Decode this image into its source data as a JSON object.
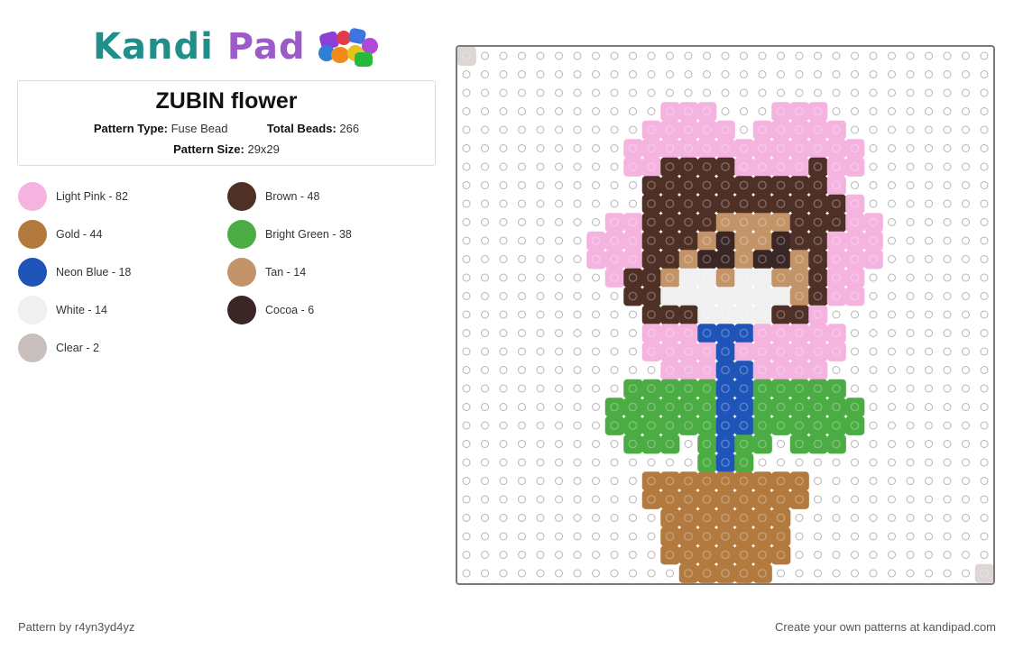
{
  "brand": {
    "logo_part1": "Kandi",
    "logo_part2": "Pad",
    "colors": {
      "kandi": "#1f8f8a",
      "pad": "#9c5bc9"
    }
  },
  "pattern": {
    "title": "ZUBIN flower",
    "type_label": "Pattern Type:",
    "type_value": "Fuse Bead",
    "total_label": "Total Beads:",
    "total_value": "266",
    "size_label": "Pattern Size:",
    "size_value": "29x29"
  },
  "legend": [
    {
      "label": "Light Pink - 82",
      "color": "#f5b3df"
    },
    {
      "label": "Brown - 48",
      "color": "#4f3027"
    },
    {
      "label": "Gold - 44",
      "color": "#b27a3f"
    },
    {
      "label": "Bright Green - 38",
      "color": "#4aac42"
    },
    {
      "label": "Neon Blue - 18",
      "color": "#1f55b8"
    },
    {
      "label": "Tan - 14",
      "color": "#c29468"
    },
    {
      "label": "White - 14",
      "color": "#f0f0f0"
    },
    {
      "label": "Cocoa - 6",
      "color": "#3a2624"
    },
    {
      "label": "Clear - 2",
      "color": "#c8bebb"
    }
  ],
  "grid": {
    "cols": 29,
    "rows": 29,
    "palette": {
      ".": "#ffffff",
      "P": "#f5b3df",
      "B": "#4f3027",
      "G": "#b27a3f",
      "E": "#4aac42",
      "N": "#1f55b8",
      "T": "#c29468",
      "W": "#f0f0f0",
      "C": "#3a2624",
      "X": "#dcd6d4"
    },
    "rows_data": [
      "X............................",
      ".............................",
      ".............................",
      "...........PPP...PPP.........",
      "..........PPPPP.PPPPP........",
      ".........PPPPPPPPPPPPP.......",
      ".........PPBBBBPPPPBPP.......",
      "..........BBBBBBBBBBP........",
      "..........BBBBBBBBBBBP.......",
      "........PPBBBBTTTTBBBPP......",
      ".......PPPBBBTCTTCBBPPP......",
      ".......PPPBBTCCTCCTBPPP......",
      "........PBBTWWTWWTTBPP.......",
      ".........BBWWWWWWWTBPP.......",
      "..........BBBWWWWBBP.........",
      "..........PPPNNNPPPPP........",
      "..........PPPPNPPPPPP........",
      "...........PPPNNPPPP.........",
      ".........EEEEENNEEEEE........",
      "........EEEEEENNEEEEEE.......",
      "........EEEEEENNEEEEEE.......",
      ".........EEE.ENEE.EEE........",
      ".............ENE.............",
      "..........GGGGGGGGG..........",
      "..........GGGGGGGGG..........",
      "...........GGGGGGG...........",
      "...........GGGGGGG...........",
      "...........GGGGGGG...........",
      "............GGGGG...........X"
    ]
  },
  "footer": {
    "author": "Pattern by r4yn3yd4yz",
    "cta": "Create your own patterns at kandipad.com"
  }
}
